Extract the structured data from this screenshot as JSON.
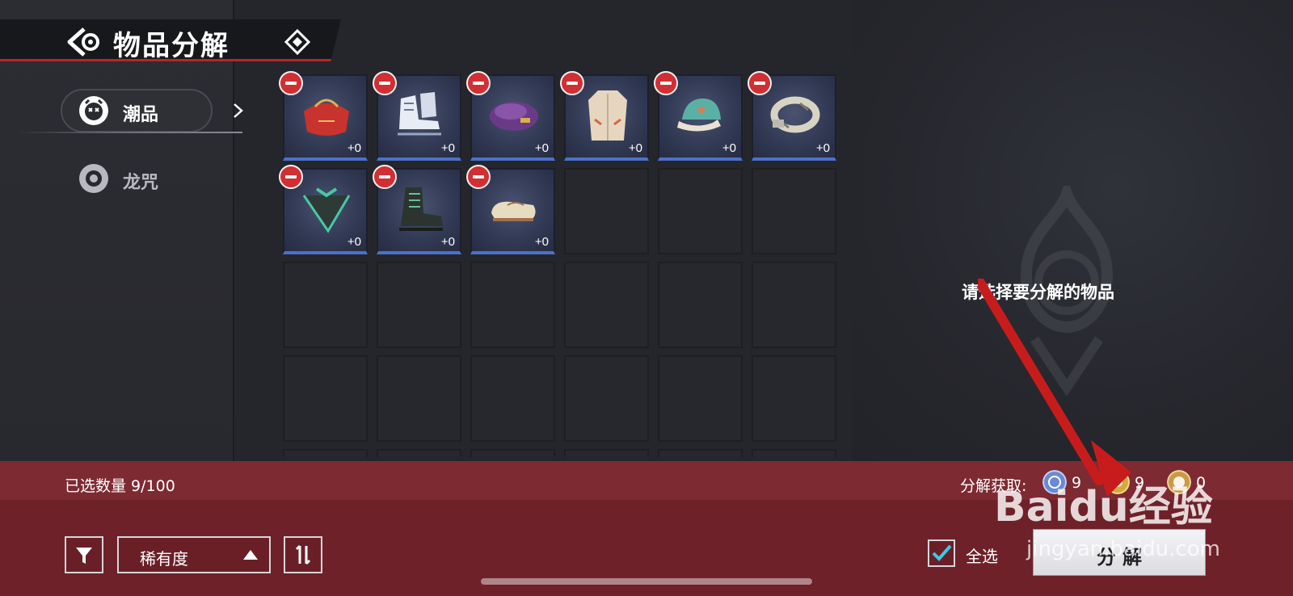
{
  "header": {
    "title": "物品分解"
  },
  "categories": [
    {
      "label": "潮品",
      "active": true
    },
    {
      "label": "龙咒",
      "active": false
    }
  ],
  "items": [
    {
      "level": "+0",
      "icon": "red-handbag-icon"
    },
    {
      "level": "+0",
      "icon": "ice-skates-icon"
    },
    {
      "level": "+0",
      "icon": "purple-beret-icon"
    },
    {
      "level": "+0",
      "icon": "trench-coat-icon"
    },
    {
      "level": "+0",
      "icon": "teal-cap-icon"
    },
    {
      "level": "+0",
      "icon": "camo-belt-icon"
    },
    {
      "level": "+0",
      "icon": "scarf-icon"
    },
    {
      "level": "+0",
      "icon": "combat-boots-icon"
    },
    {
      "level": "+0",
      "icon": "loafers-icon"
    }
  ],
  "hint": "请选择要分解的物品",
  "footer": {
    "selected_count": "已选数量 9/100",
    "yield_label": "分解获取:",
    "yields": [
      {
        "icon": "blue-coin-icon",
        "value": "9"
      },
      {
        "icon": "gold-coin-icon",
        "value": "9"
      },
      {
        "icon": "pearl-coin-icon",
        "value": "0"
      }
    ],
    "sort_label": "稀有度",
    "select_all_label": "全选",
    "select_all_checked": true,
    "decompose_label": "分解"
  },
  "watermark": {
    "text": "Baidu经验",
    "url": "jingyan.baidu.com"
  },
  "colors": {
    "accent_red": "#b3272b",
    "footer_red": "#7e2a33",
    "item_border_blue": "#4a72c8",
    "remove_red": "#d22f33"
  }
}
